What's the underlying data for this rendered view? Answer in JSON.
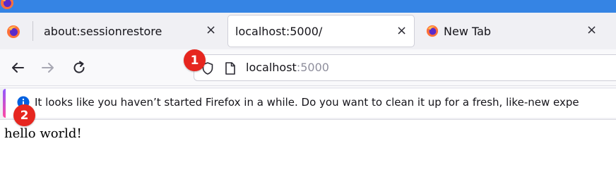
{
  "colors": {
    "title_strip": "#3584e4",
    "tab_strip": "#f0f0f4",
    "marker": "#e6261f",
    "info_blue": "#0060df"
  },
  "tabs": [
    {
      "label": "about:sessionrestore",
      "close": "×",
      "active": false
    },
    {
      "label": "localhost:5000/",
      "close": "×",
      "active": true
    },
    {
      "label": "New Tab",
      "close": "×",
      "active": false,
      "icon": "firefox-icon"
    }
  ],
  "toolbar": {
    "back_icon": "back-arrow-icon",
    "forward_icon": "forward-arrow-icon",
    "reload_icon": "reload-icon",
    "url": {
      "host": "localhost",
      "port": ":5000"
    }
  },
  "notification": {
    "icon": "info-icon",
    "text": "It looks like you haven’t started Firefox in a while. Do you want to clean it up for a fresh, like-new expe"
  },
  "page": {
    "text": "hello world!"
  },
  "markers": [
    "1",
    "2"
  ]
}
